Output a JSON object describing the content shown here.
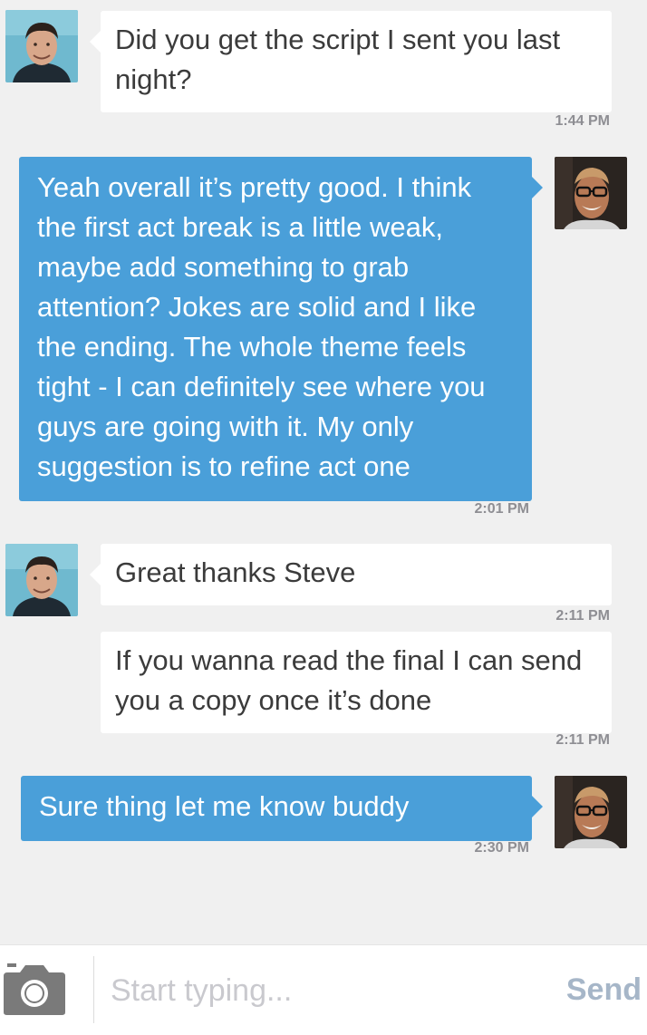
{
  "messages": [
    {
      "text": "Did you get the script I sent you last night?",
      "time": "1:44 PM"
    },
    {
      "text": "Yeah overall it’s pretty good. I think the first act break is a little weak, maybe add something to grab attention? Jokes are solid and I like the ending. The whole theme feels tight - I can definitely see where you guys are going with it. My only suggestion is to refine act one",
      "time": "2:01 PM"
    },
    {
      "text": "Great thanks Steve",
      "time": "2:11 PM"
    },
    {
      "text": "If you wanna read the final I can send you a copy once it’s done",
      "time": "2:11 PM"
    },
    {
      "text": "Sure thing let me know buddy",
      "time": "2:30 PM"
    }
  ],
  "composer": {
    "placeholder": "Start typing...",
    "send_label": "Send"
  },
  "colors": {
    "outgoing_bubble": "#4a9fd9",
    "incoming_bubble": "#ffffff",
    "background": "#f0f0f0"
  }
}
